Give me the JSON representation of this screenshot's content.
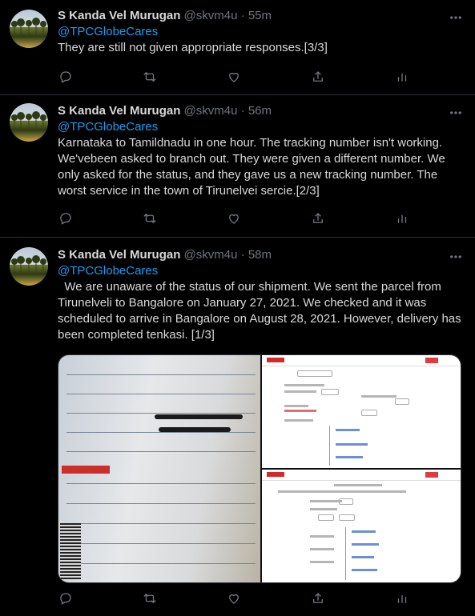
{
  "tweets": [
    {
      "name": "S Kanda Vel Murugan",
      "handle": "@skvm4u",
      "separator": "·",
      "time": "55m",
      "mention": "@TPCGlobeCares",
      "text": "They are still not given appropriate responses.[3/3]"
    },
    {
      "name": "S Kanda Vel Murugan",
      "handle": "@skvm4u",
      "separator": "·",
      "time": "56m",
      "mention": "@TPCGlobeCares",
      "text": "Karnataka to Tamildnadu in one hour. The tracking number isn't working. We'vebeen asked to branch out. They were given a different number. We only asked for the status, and they gave us a new tracking number. The worst service in the town of Tirunelvei sercie.[2/3]"
    },
    {
      "name": "S Kanda Vel Murugan",
      "handle": "@skvm4u",
      "separator": "·",
      "time": "58m",
      "mention": "@TPCGlobeCares",
      "text": "  We are unaware of the status of our shipment. We sent the parcel from Tirunelveli to Bangalore on January 27, 2021. We checked and it was scheduled to arrive in Bangalore on August 28, 2021. However, delivery has been completed tenkasi. [1/3]"
    }
  ],
  "icons": {
    "more": "more-icon",
    "reply": "reply-icon",
    "retweet": "retweet-icon",
    "like": "like-icon",
    "share": "share-icon",
    "analytics": "analytics-icon"
  },
  "colors": {
    "background": "#000000",
    "text": "#d9d9d9",
    "muted": "#6e767d",
    "link": "#1d9bf0",
    "divider": "#2f3336"
  }
}
